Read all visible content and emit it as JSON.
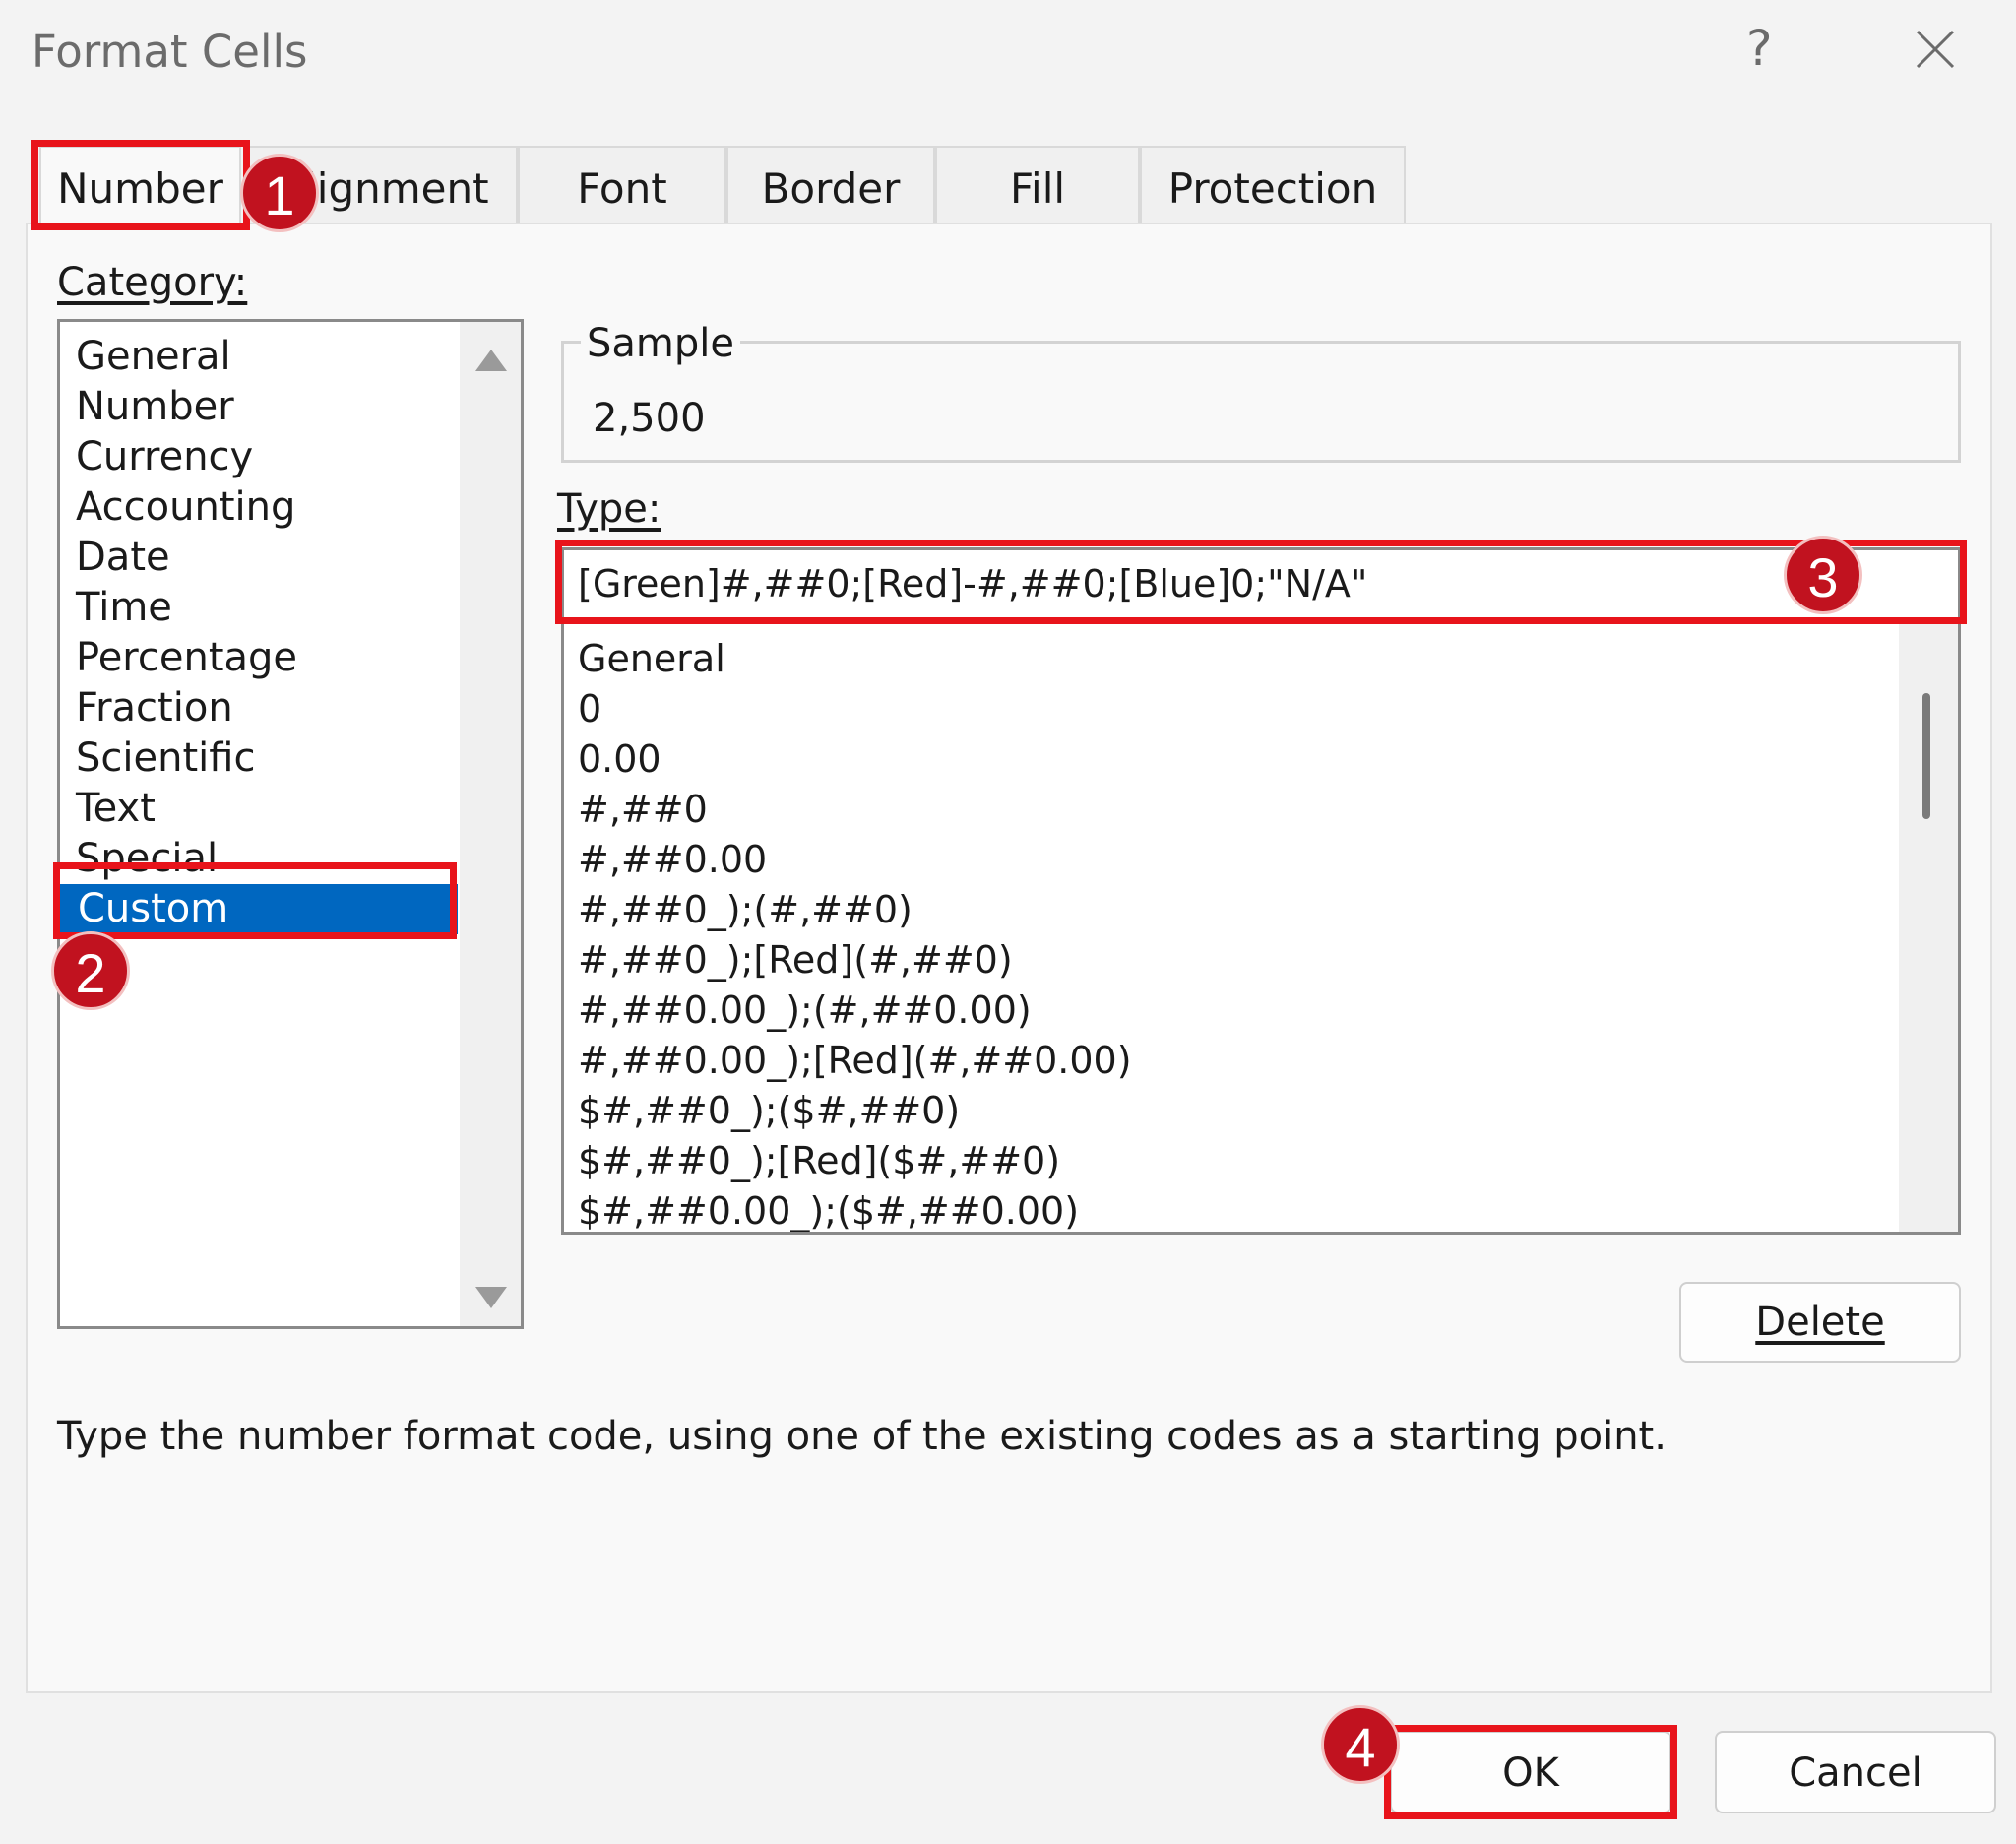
{
  "window": {
    "title": "Format Cells"
  },
  "tabs": [
    {
      "label": "Number"
    },
    {
      "label": "Alignment"
    },
    {
      "label": "Font"
    },
    {
      "label": "Border"
    },
    {
      "label": "Fill"
    },
    {
      "label": "Protection"
    }
  ],
  "category": {
    "label": "Category:",
    "items": [
      "General",
      "Number",
      "Currency",
      "Accounting",
      "Date",
      "Time",
      "Percentage",
      "Fraction",
      "Scientific",
      "Text",
      "Special",
      "Custom"
    ],
    "selected": "Custom"
  },
  "sample": {
    "label": "Sample",
    "value": "2,500"
  },
  "type": {
    "label": "Type:",
    "value": "[Green]#,##0;[Red]-#,##0;[Blue]0;\"N/A\"",
    "items": [
      "General",
      "0",
      "0.00",
      "#,##0",
      "#,##0.00",
      "#,##0_);(#,##0)",
      "#,##0_);[Red](#,##0)",
      "#,##0.00_);(#,##0.00)",
      "#,##0.00_);[Red](#,##0.00)",
      "$#,##0_);($#,##0)",
      "$#,##0_);[Red]($#,##0)",
      "$#,##0.00_);($#,##0.00)"
    ]
  },
  "buttons": {
    "delete": "Delete",
    "ok": "OK",
    "cancel": "Cancel"
  },
  "description": "Type the number format code, using one of the existing codes as a starting point.",
  "annotations": [
    "1",
    "2",
    "3",
    "4"
  ],
  "colors": {
    "highlight": "#e8141b",
    "selection": "#0067c0",
    "badge": "#c1121f"
  }
}
